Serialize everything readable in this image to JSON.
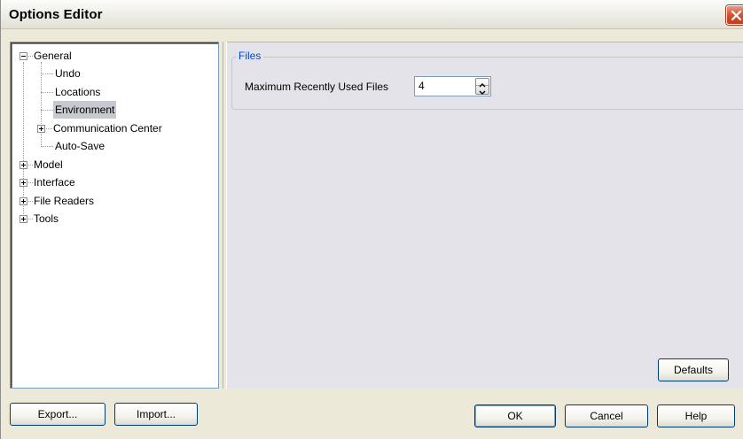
{
  "window": {
    "title": "Options Editor",
    "close_icon": "close-icon",
    "close_color": "#d7502f"
  },
  "tree": {
    "items": [
      {
        "label": "General",
        "level": 0,
        "expander": "minus"
      },
      {
        "label": "Undo",
        "level": 1,
        "expander": "none"
      },
      {
        "label": "Locations",
        "level": 1,
        "expander": "none"
      },
      {
        "label": "Environment",
        "level": 1,
        "expander": "none",
        "selected": true
      },
      {
        "label": "Communication Center",
        "level": 1,
        "expander": "plus"
      },
      {
        "label": "Auto-Save",
        "level": 1,
        "expander": "none"
      },
      {
        "label": "Model",
        "level": 0,
        "expander": "plus"
      },
      {
        "label": "Interface",
        "level": 0,
        "expander": "plus"
      },
      {
        "label": "File Readers",
        "level": 0,
        "expander": "plus"
      },
      {
        "label": "Tools",
        "level": 0,
        "expander": "plus"
      }
    ]
  },
  "files_group": {
    "legend": "Files",
    "legend_color": "#0046d5",
    "mru_label": "Maximum Recently Used Files",
    "mru_value": "4"
  },
  "buttons": {
    "defaults": "Defaults",
    "export": "Export...",
    "import": "Import...",
    "ok": "OK",
    "cancel": "Cancel",
    "help": "Help"
  }
}
